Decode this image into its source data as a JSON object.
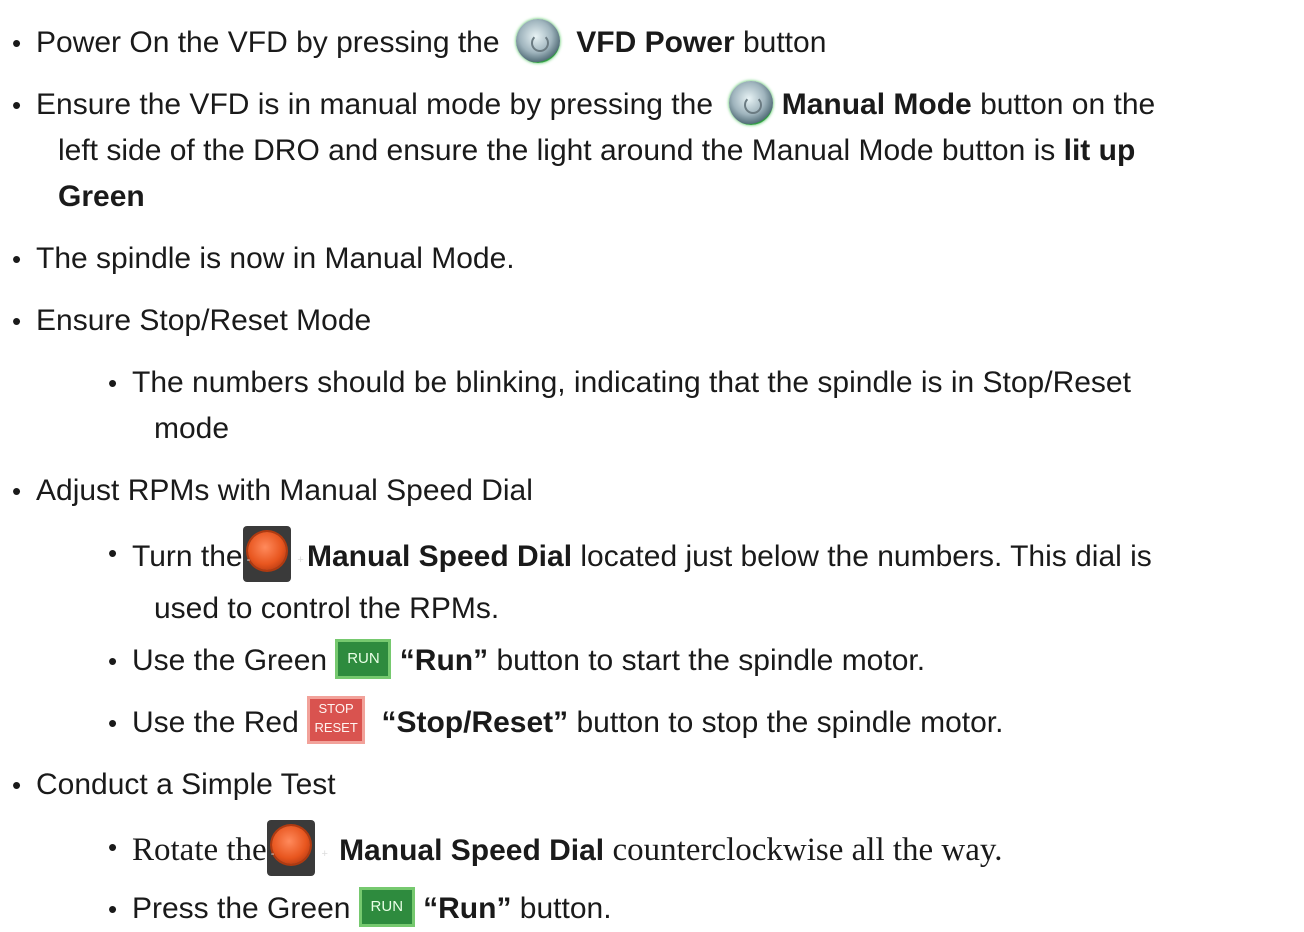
{
  "bullet": "•",
  "items": [
    {
      "pre": "Power On the VFD by pressing the",
      "bold": "VFD Power",
      "post": "button",
      "icon": "vfd-power-button-icon"
    },
    {
      "pre": "Ensure the VFD is in manual mode by pressing the",
      "bold": "Manual Mode",
      "post": "button on the",
      "line2": "left side of the DRO and ensure the light around the Manual Mode button is",
      "bold2": "lit up",
      "line3": "Green",
      "icon": "manual-mode-button-icon"
    },
    {
      "text": "The spindle is now in Manual Mode."
    },
    {
      "text": "Ensure Stop/Reset Mode"
    },
    {
      "text": "The numbers should be blinking, indicating that the spindle is in Stop/Reset",
      "line2": "mode"
    },
    {
      "text": "Adjust RPMs with Manual Speed Dial"
    },
    {
      "pre": "Turn the",
      "bold": "Manual Speed Dial",
      "post": "located just below the numbers. This dial is",
      "line2": "used to control the RPMs.",
      "icon": "manual-speed-dial-icon"
    },
    {
      "pre": "Use the Green",
      "bold": "“Run”",
      "post": "button to start the spindle motor.",
      "icon": "run-button-icon",
      "icon_label": "RUN"
    },
    {
      "pre": "Use the Red",
      "bold": "“Stop/Reset”",
      "post": "button to stop the spindle motor.",
      "icon": "stop-reset-button-icon",
      "icon_label_1": "STOP",
      "icon_label_2": "RESET"
    },
    {
      "text": "Conduct a Simple Test"
    },
    {
      "pre": "Rotate the",
      "bold": "Manual Speed Dial",
      "post": "counterclockwise all the way.",
      "icon": "manual-speed-dial-icon"
    },
    {
      "pre": "Press the Green",
      "bold": "“Run”",
      "post": "button.",
      "icon": "run-button-icon",
      "icon_label": "RUN"
    }
  ]
}
